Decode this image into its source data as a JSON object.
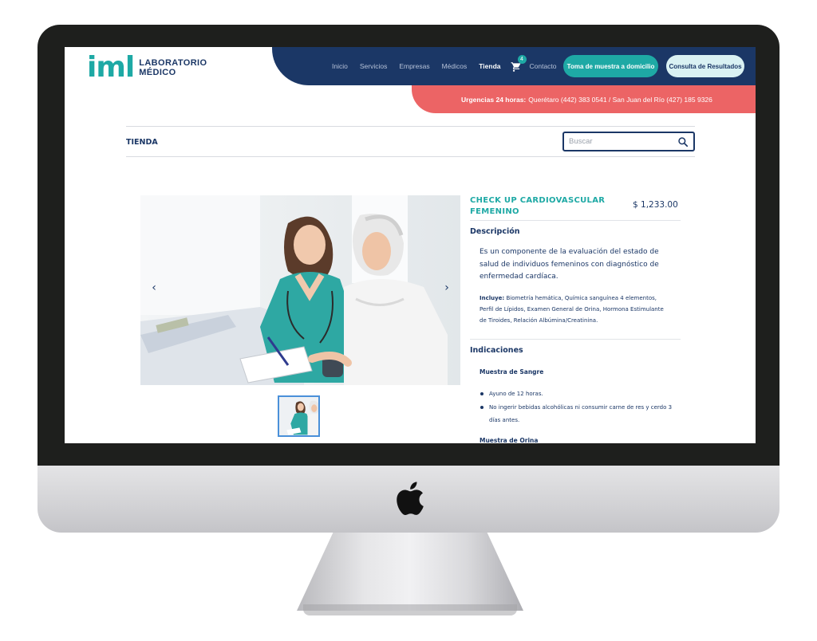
{
  "logo": {
    "mark": "iml",
    "line1": "LABORATORIO",
    "line2": "MÉDICO"
  },
  "nav": {
    "items": [
      {
        "label": "Inicio",
        "active": false
      },
      {
        "label": "Servicios",
        "active": false
      },
      {
        "label": "Empresas",
        "active": false
      },
      {
        "label": "Médicos",
        "active": false
      },
      {
        "label": "Tienda",
        "active": true
      }
    ],
    "cart_icon": "shopping-cart-icon",
    "cart_count": "4",
    "contact_label": "Contacto",
    "home_sample_button": "Toma de muestra a domicilio",
    "results_button": "Consulta de Resultados"
  },
  "urgent": {
    "label": "Urgencias 24 horas:",
    "text": "Querétaro (442) 383 0541 / San Juan del Río (427) 185 9326"
  },
  "store": {
    "title": "TIENDA",
    "search_placeholder": "Buscar",
    "search_icon": "search-icon"
  },
  "gallery": {
    "prev_icon": "chevron-left-icon",
    "next_icon": "chevron-right-icon",
    "prev_glyph": "‹",
    "next_glyph": "›"
  },
  "product": {
    "name": "CHECK UP CARDIOVASCULAR FEMENINO",
    "price": "$ 1,233.00",
    "description_heading": "Descripción",
    "description": "Es un componente de la evaluación del estado de salud de individuos femeninos con diagnóstico de enfermedad cardíaca.",
    "includes_label": "Incluye:",
    "includes_text": "Biometría hemática, Química sanguínea 4 elementos, Perfil de Lípidos, Examen General de Orina, Hormona Estimulante de Tiroides, Relación Albúmina/Creatinina.",
    "indications_heading": "Indicaciones",
    "blood_heading": "Muestra de Sangre",
    "blood_items": [
      "Ayuno de 12 horas.",
      "No ingerir bebidas alcohólicas ni consumir carne de res y cerdo 3 días antes."
    ],
    "urine_heading": "Muestra de Orina"
  },
  "colors": {
    "navy": "#1b3766",
    "teal": "#1ea9a5",
    "coral": "#ec6465",
    "light_teal": "#d9f1f3"
  }
}
